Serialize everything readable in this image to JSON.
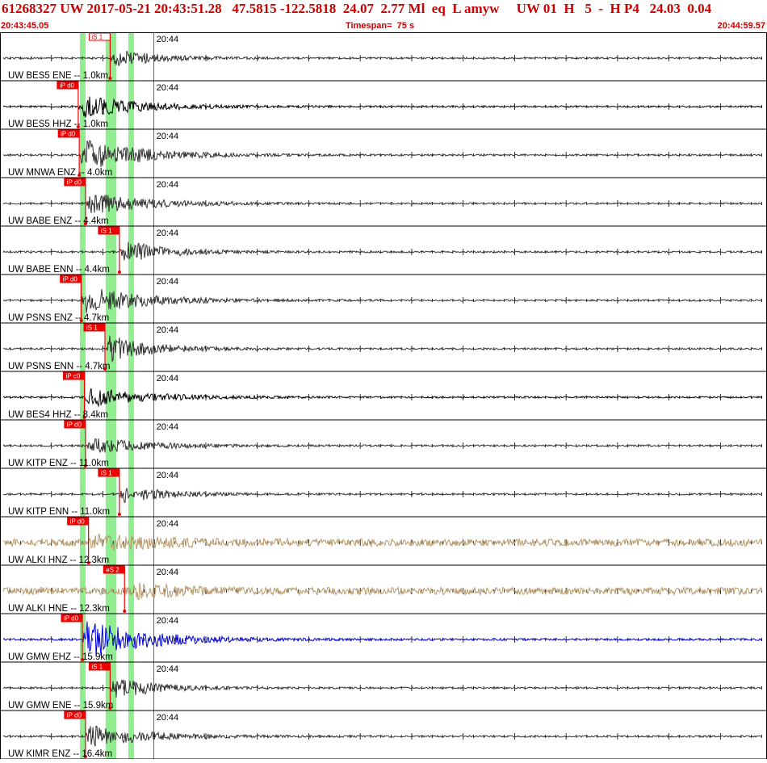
{
  "header": {
    "event_line": "61268327 UW 2017-05-21 20:43:51.28   47.5815 -122.5818  24.07  2.77 Ml  eq  L amyw     UW 01  H   5  -  H P4   24.03  0.04",
    "start_time": "20:43:45.05",
    "timespan": "Timespan=  75 s",
    "end_time": "20:44:59.57"
  },
  "timeline": {
    "minute_label": "20:44",
    "green_markers_sec": [
      8.0,
      10.5,
      11.0,
      12.7
    ]
  },
  "colors": {
    "header_text": "#cc0000",
    "pick_box": "#ee0000",
    "green_marker": "#90ee90",
    "trace_default": "#333333",
    "trace_hh": "#000000",
    "trace_accel": "#b8996a",
    "trace_blue": "#0000dd"
  },
  "channels": [
    {
      "label": "UW BES5 ENE -- 1.0km",
      "pick": "iS 1",
      "pick_hollow": true,
      "pick_sec": 10.7,
      "amp": 0.45,
      "color": "trace_default",
      "type": "S"
    },
    {
      "label": "UW BES5 HHZ -- 1.0km",
      "pick": "iP d0",
      "pick_hollow": false,
      "pick_sec": 7.6,
      "amp": 0.55,
      "color": "trace_hh",
      "type": "P"
    },
    {
      "label": "UW MNWA ENZ -- 4.0km",
      "pick": "iP d0",
      "pick_hollow": false,
      "pick_sec": 7.7,
      "amp": 0.8,
      "color": "trace_default",
      "type": "P"
    },
    {
      "label": "UW BABE ENZ -- 4.4km",
      "pick": "iP d0",
      "pick_hollow": false,
      "pick_sec": 8.3,
      "amp": 0.55,
      "color": "trace_default",
      "type": "P"
    },
    {
      "label": "UW BABE ENN -- 4.4km",
      "pick": "iS 1",
      "pick_hollow": false,
      "pick_sec": 11.6,
      "amp": 0.6,
      "color": "trace_default",
      "type": "S"
    },
    {
      "label": "UW PSNS ENZ -- 4.7km",
      "pick": "iP d0",
      "pick_hollow": false,
      "pick_sec": 7.9,
      "amp": 0.7,
      "color": "trace_default",
      "type": "P"
    },
    {
      "label": "UW PSNS ENN -- 4.7km",
      "pick": "iS 1",
      "pick_hollow": false,
      "pick_sec": 10.2,
      "amp": 0.7,
      "color": "trace_default",
      "type": "S"
    },
    {
      "label": "UW BES4 HHZ -- 8.4km",
      "pick": "iP c0",
      "pick_hollow": false,
      "pick_sec": 8.2,
      "amp": 0.5,
      "color": "trace_hh",
      "type": "P"
    },
    {
      "label": "UW KITP ENZ -- 11.0km",
      "pick": "iP d0",
      "pick_hollow": false,
      "pick_sec": 8.3,
      "amp": 0.4,
      "color": "trace_default",
      "type": "P"
    },
    {
      "label": "UW KITP ENN -- 11.0km",
      "pick": "iS 1",
      "pick_hollow": false,
      "pick_sec": 11.6,
      "amp": 0.45,
      "color": "trace_default",
      "type": "S"
    },
    {
      "label": "UW ALKI HNZ -- 12.3km",
      "pick": "iP d0",
      "pick_hollow": false,
      "pick_sec": 8.6,
      "amp": 0.35,
      "color": "trace_accel",
      "type": "P"
    },
    {
      "label": "UW ALKI HNE -- 12.3km",
      "pick": "eS 2",
      "pick_hollow": false,
      "pick_sec": 12.1,
      "amp": 0.35,
      "color": "trace_accel",
      "type": "S"
    },
    {
      "label": "UW GMW EHZ -- 15.9km",
      "pick": "iP d0",
      "pick_hollow": false,
      "pick_sec": 8.0,
      "amp": 1.0,
      "color": "trace_blue",
      "type": "P"
    },
    {
      "label": "UW GMW ENE -- 15.9km",
      "pick": "iS 1",
      "pick_hollow": false,
      "pick_sec": 10.7,
      "amp": 0.55,
      "color": "trace_default",
      "type": "S"
    },
    {
      "label": "UW KIMR ENZ -- 16.4km",
      "pick": "iP d0",
      "pick_hollow": false,
      "pick_sec": 8.3,
      "amp": 0.55,
      "color": "trace_default",
      "type": "P"
    }
  ]
}
